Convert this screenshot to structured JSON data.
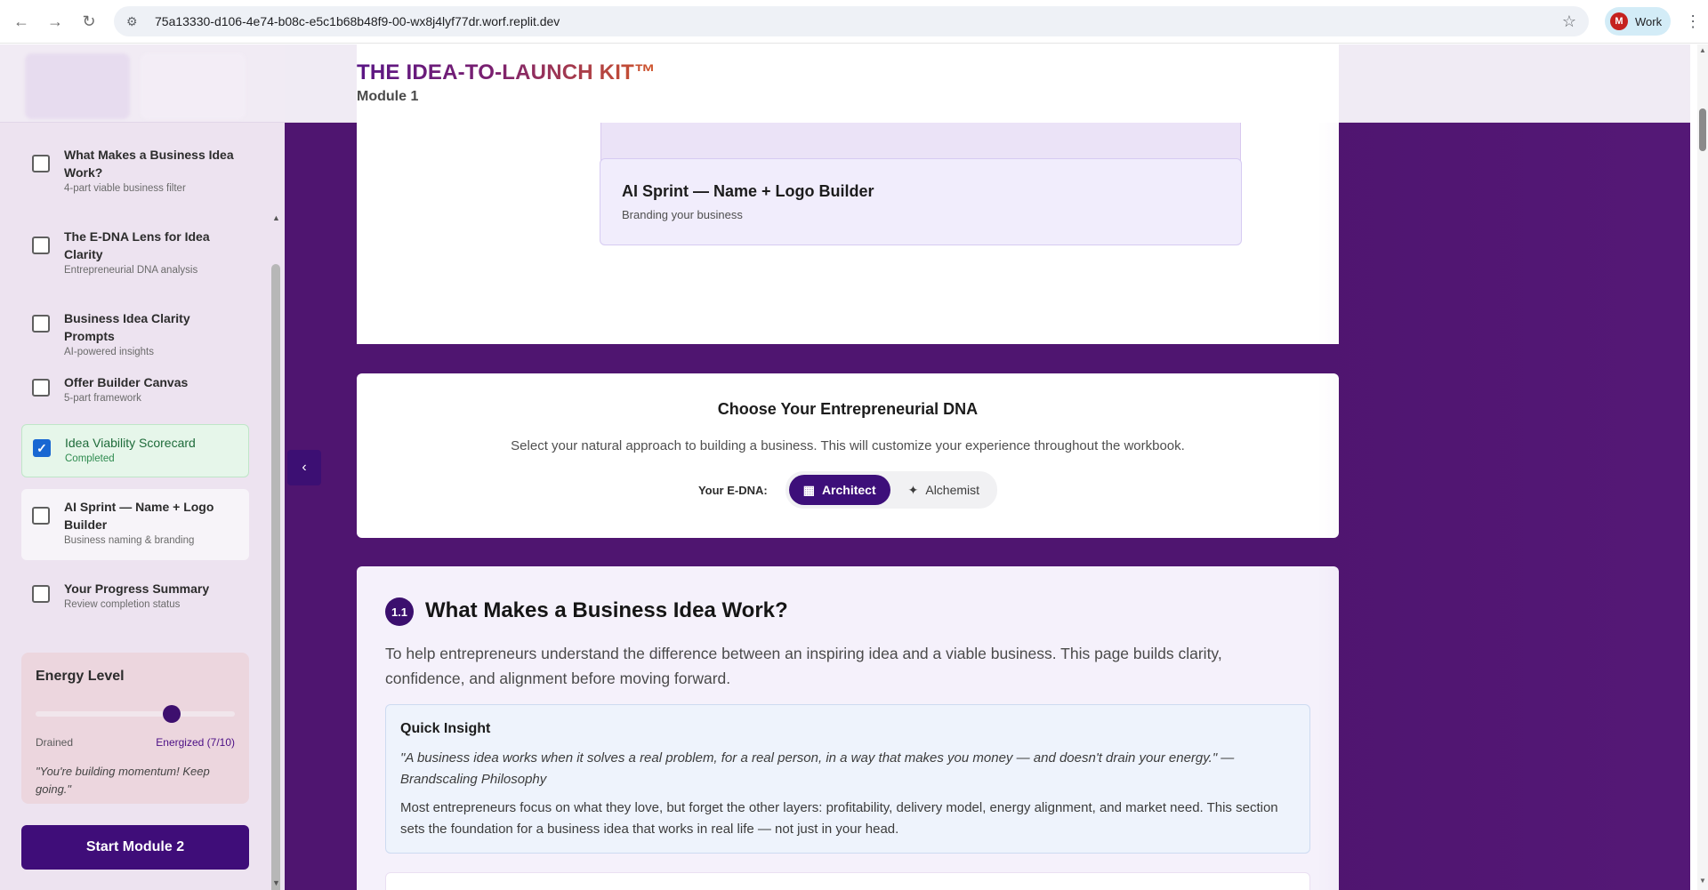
{
  "browser": {
    "url": "75a13330-d106-4e74-b08c-e5c1b68b48f9-00-wx8j4lyf77dr.worf.replit.dev",
    "profile_initial": "M",
    "profile_label": "Work"
  },
  "header": {
    "brand": "THE IDEA-TO-LAUNCH KIT™",
    "module": "Module 1"
  },
  "sidebar": {
    "lessons": [
      {
        "title": "What Makes a Business Idea Work?",
        "subtitle": "4-part viable business filter",
        "checked": false
      },
      {
        "title": "The E-DNA Lens for Idea Clarity",
        "subtitle": "Entrepreneurial DNA analysis",
        "checked": false
      },
      {
        "title": "Business Idea Clarity Prompts",
        "subtitle": "AI-powered insights",
        "checked": false
      },
      {
        "title": "Offer Builder Canvas",
        "subtitle": "5-part framework",
        "checked": false
      },
      {
        "title": "Idea Viability Scorecard",
        "subtitle": "Completed",
        "checked": true
      },
      {
        "title": "AI Sprint — Name + Logo Builder",
        "subtitle": "Business naming & branding",
        "checked": false
      },
      {
        "title": "Your Progress Summary",
        "subtitle": "Review completion status",
        "checked": false
      }
    ],
    "energy": {
      "heading": "Energy Level",
      "value": 7,
      "max": 10,
      "min_label": "Drained",
      "current_label": "Energized (7/10)",
      "quote": "\"You're building momentum! Keep going.\""
    },
    "start_button": "Start Module 2"
  },
  "content": {
    "blurred_card_title": "Idea Viability Scorecard",
    "sprint_card": {
      "title": "AI Sprint — Name + Logo Builder",
      "subtitle": "Branding your business"
    },
    "dna": {
      "heading": "Choose Your Entrepreneurial DNA",
      "description": "Select your natural approach to building a business. This will customize your experience throughout the workbook.",
      "label": "Your E-DNA:",
      "options": [
        {
          "label": "Architect",
          "selected": true,
          "icon": "building-icon"
        },
        {
          "label": "Alchemist",
          "selected": false,
          "icon": "sparkles-icon"
        }
      ]
    },
    "section": {
      "number": "1.1",
      "title": "What Makes a Business Idea Work?",
      "intro": "To help entrepreneurs understand the difference between an inspiring idea and a viable business. This page builds clarity, confidence, and alignment before moving forward.",
      "insight_heading": "Quick Insight",
      "insight_quote": "\"A business idea works when it solves a real problem, for a real person, in a way that makes you money — and doesn't drain your energy.\" — Brandscaling Philosophy",
      "insight_body": "Most entrepreneurs focus on what they love, but forget the other layers: profitability, delivery model, energy alignment, and market need. This section sets the foundation for a business idea that works in real life — not just in your head."
    }
  },
  "colors": {
    "primary": "#3f0d79",
    "main_bg": "#4f1570",
    "success": "#1e6b3a"
  }
}
